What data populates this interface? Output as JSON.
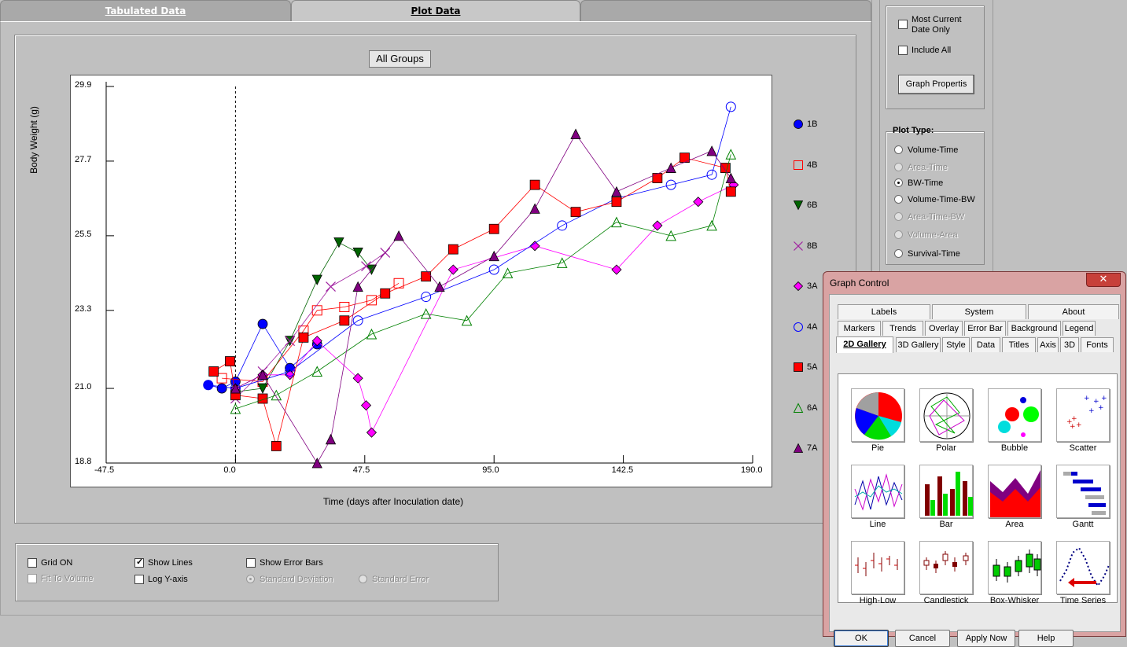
{
  "tabs": [
    {
      "label": "Tabulated Data",
      "active": false
    },
    {
      "label": "Plot Data",
      "active": true
    },
    {
      "label": "",
      "active": false
    }
  ],
  "plot_header_button": "All Groups",
  "chart_data": {
    "type": "scatter",
    "xlabel": "Time (days after Inoculation date)",
    "ylabel": "Body Weight (g)",
    "xlim": [
      -47.5,
      190.0
    ],
    "ylim": [
      18.8,
      29.9
    ],
    "xticks": [
      "-47.5",
      "0.0",
      "47.5",
      "95.0",
      "142.5",
      "190.0"
    ],
    "yticks": [
      "18.8",
      "21.0",
      "23.3",
      "25.5",
      "27.7",
      "29.9"
    ],
    "x_values": [
      -47.5,
      0.0,
      47.5,
      95.0,
      142.5,
      190.0
    ],
    "y_values": [
      18.8,
      21.0,
      23.3,
      25.5,
      27.7,
      29.9
    ],
    "vertical_reference_x": 0.0,
    "grid": false,
    "lines": true,
    "legend_placement": "right",
    "series": [
      {
        "name": "1B",
        "marker": "circle-filled",
        "color": "#0000ff",
        "points": [
          [
            -10,
            21.1
          ],
          [
            -5,
            21.0
          ],
          [
            0,
            21.2
          ],
          [
            10,
            22.9
          ],
          [
            20,
            21.6
          ],
          [
            30,
            22.3
          ]
        ]
      },
      {
        "name": "4B",
        "marker": "square-open",
        "color": "#ff0000",
        "points": [
          [
            -5,
            21.3
          ],
          [
            10,
            21.2
          ],
          [
            25,
            22.7
          ],
          [
            30,
            23.3
          ],
          [
            40,
            23.4
          ],
          [
            50,
            23.6
          ],
          [
            60,
            24.1
          ]
        ]
      },
      {
        "name": "6B",
        "marker": "triangle-down-filled",
        "color": "#006400",
        "points": [
          [
            0,
            20.9
          ],
          [
            10,
            21.0
          ],
          [
            20,
            22.4
          ],
          [
            30,
            24.2
          ],
          [
            38,
            25.3
          ],
          [
            45,
            25.0
          ],
          [
            50,
            24.5
          ]
        ]
      },
      {
        "name": "8B",
        "marker": "x",
        "color": "#a020a0",
        "points": [
          [
            0,
            20.7
          ],
          [
            10,
            21.5
          ],
          [
            20,
            22.4
          ],
          [
            35,
            24.0
          ],
          [
            48,
            24.6
          ],
          [
            55,
            25.0
          ]
        ]
      },
      {
        "name": "3A",
        "marker": "diamond-filled",
        "color": "#ff00ff",
        "points": [
          [
            0,
            21.0
          ],
          [
            10,
            21.4
          ],
          [
            20,
            21.4
          ],
          [
            30,
            22.4
          ],
          [
            45,
            21.3
          ],
          [
            48,
            20.5
          ],
          [
            50,
            19.7
          ],
          [
            80,
            24.5
          ],
          [
            110,
            25.2
          ],
          [
            140,
            24.5
          ],
          [
            155,
            25.8
          ],
          [
            170,
            26.5
          ],
          [
            183,
            27.0
          ]
        ]
      },
      {
        "name": "4A",
        "marker": "circle-open",
        "color": "#0000ff",
        "points": [
          [
            -10,
            21.1
          ],
          [
            0,
            21.0
          ],
          [
            20,
            21.5
          ],
          [
            45,
            23.0
          ],
          [
            70,
            23.7
          ],
          [
            95,
            24.5
          ],
          [
            120,
            25.8
          ],
          [
            140,
            26.6
          ],
          [
            160,
            27.0
          ],
          [
            175,
            27.3
          ],
          [
            182,
            29.3
          ]
        ]
      },
      {
        "name": "5A",
        "marker": "square-filled",
        "color": "#ff0000",
        "points": [
          [
            -8,
            21.5
          ],
          [
            -2,
            21.8
          ],
          [
            0,
            20.8
          ],
          [
            10,
            20.7
          ],
          [
            15,
            19.3
          ],
          [
            25,
            22.5
          ],
          [
            40,
            23.0
          ],
          [
            55,
            23.8
          ],
          [
            70,
            24.3
          ],
          [
            80,
            25.1
          ],
          [
            95,
            25.7
          ],
          [
            110,
            27.0
          ],
          [
            125,
            26.2
          ],
          [
            140,
            26.5
          ],
          [
            155,
            27.2
          ],
          [
            165,
            27.8
          ],
          [
            180,
            27.5
          ],
          [
            182,
            26.8
          ]
        ]
      },
      {
        "name": "6A",
        "marker": "triangle-up-open",
        "color": "#008000",
        "points": [
          [
            0,
            20.4
          ],
          [
            15,
            20.8
          ],
          [
            30,
            21.5
          ],
          [
            50,
            22.6
          ],
          [
            70,
            23.2
          ],
          [
            85,
            23.0
          ],
          [
            100,
            24.4
          ],
          [
            120,
            24.7
          ],
          [
            140,
            25.9
          ],
          [
            160,
            25.5
          ],
          [
            175,
            25.8
          ],
          [
            182,
            27.9
          ]
        ]
      },
      {
        "name": "7A",
        "marker": "triangle-up-filled",
        "color": "#800080",
        "points": [
          [
            0,
            21.0
          ],
          [
            10,
            21.4
          ],
          [
            30,
            18.8
          ],
          [
            35,
            19.5
          ],
          [
            45,
            24.0
          ],
          [
            60,
            25.5
          ],
          [
            75,
            24.0
          ],
          [
            95,
            24.9
          ],
          [
            110,
            26.3
          ],
          [
            125,
            28.5
          ],
          [
            140,
            26.8
          ],
          [
            160,
            27.5
          ],
          [
            175,
            28.0
          ],
          [
            182,
            27.2
          ]
        ]
      }
    ]
  },
  "options": {
    "grid_on": {
      "label": "Grid ON",
      "checked": false
    },
    "fit_to_volume": {
      "label": "Fit To Volume",
      "checked": false
    },
    "show_lines": {
      "label": "Show Lines",
      "checked": true
    },
    "log_y_axis": {
      "label": "Log Y-axis",
      "checked": false
    },
    "show_error_bars": {
      "label": "Show Error Bars",
      "checked": false
    },
    "standard_deviation": {
      "label": "Standard Deviation",
      "selected": true
    },
    "standard_error": {
      "label": "Standard Error",
      "selected": false
    }
  },
  "side": {
    "most_current": {
      "line1": "Most Current",
      "line2": "Date Only",
      "checked": false
    },
    "include_all": {
      "label": "Include All",
      "checked": false
    },
    "graph_props_button": "Graph Propertis",
    "plot_type_title": "Plot Type:",
    "plot_types": [
      {
        "label": "Volume-Time",
        "selected": false,
        "enabled": true
      },
      {
        "label": "Area-Time",
        "selected": false,
        "enabled": false
      },
      {
        "label": "BW-Time",
        "selected": true,
        "enabled": true
      },
      {
        "label": "Volume-Time-BW",
        "selected": false,
        "enabled": true
      },
      {
        "label": "Area-Time-BW",
        "selected": false,
        "enabled": false
      },
      {
        "label": "Volume-Area",
        "selected": false,
        "enabled": false
      },
      {
        "label": "Survival-Time",
        "selected": false,
        "enabled": true
      }
    ]
  },
  "dialog": {
    "title": "Graph Control",
    "close_glyph": "✕",
    "tab_rows": [
      [
        "Labels",
        "System",
        "About"
      ],
      [
        "Markers",
        "Trends",
        "Overlay",
        "Error Bar",
        "Background",
        "Legend"
      ],
      [
        "2D Gallery",
        "3D Gallery",
        "Style",
        "Data",
        "Titles",
        "Axis",
        "3D",
        "Fonts"
      ]
    ],
    "active_tab": "2D Gallery",
    "gallery": [
      "Pie",
      "Polar",
      "Bubble",
      "Scatter",
      "Line",
      "Bar",
      "Area",
      "Gantt",
      "High-Low",
      "Candlestick",
      "Box-Whisker",
      "Time Series"
    ],
    "buttons": {
      "ok": "OK",
      "cancel": "Cancel",
      "apply": "Apply Now",
      "help": "Help"
    }
  },
  "colors": {
    "window_bg": "#c0c0c0",
    "dialog_frame": "#d9a3a3",
    "close_red": "#c7403a"
  }
}
